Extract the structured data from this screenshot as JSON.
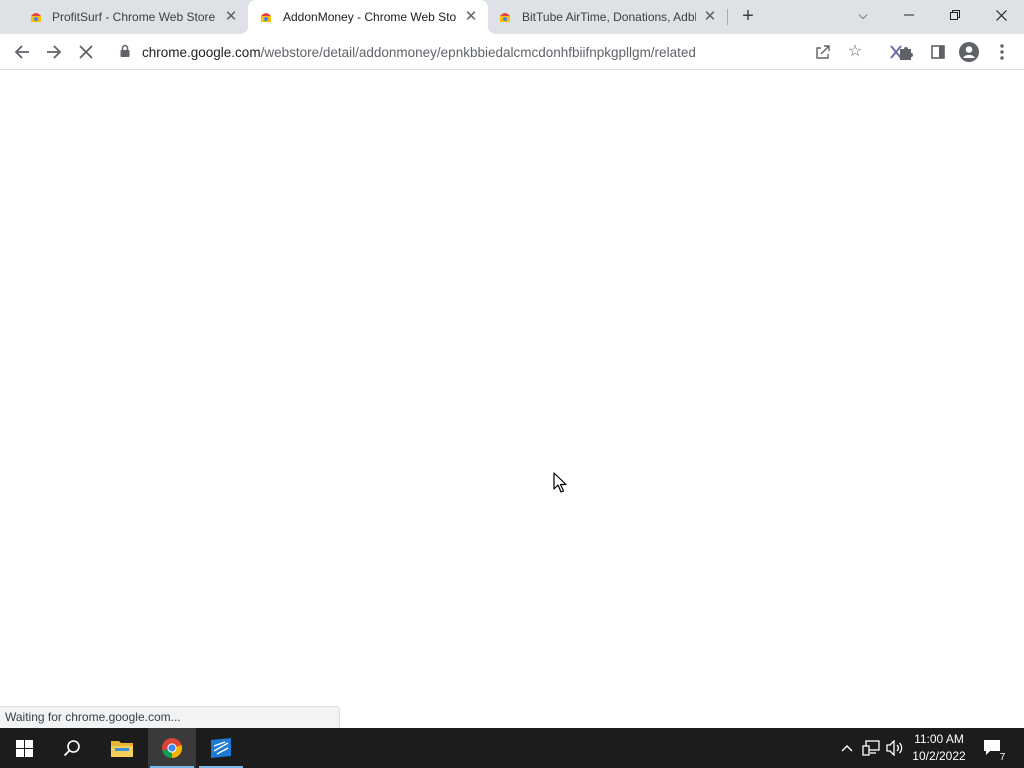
{
  "browser": {
    "tabs": [
      {
        "title": "ProfitSurf - Chrome Web Store",
        "active": false
      },
      {
        "title": "AddonMoney - Chrome Web Sto",
        "active": true
      },
      {
        "title": "BitTube AirTime, Donations, Adbl",
        "active": false
      }
    ],
    "url": {
      "host": "chrome.google.com",
      "path": "/webstore/detail/addonmoney/epnkbbiedalcmcdonhfbiifnpkgpllgm/related"
    },
    "status_text": "Waiting for chrome.google.com..."
  },
  "taskbar": {
    "time": "11:00 AM",
    "date": "10/2/2022",
    "notification_count": "7"
  },
  "icons": {
    "back": "arrow-left-icon",
    "forward": "arrow-right-icon",
    "reload": "stop-loading-icon",
    "lock": "lock-icon",
    "share": "share-icon",
    "bookmark": "star-icon",
    "extensions": "puzzle-icon",
    "side_panel": "side-panel-icon",
    "profile": "profile-icon",
    "menu": "kebab-menu-icon"
  },
  "colors": {
    "tab_strip": "#dee1e6",
    "taskbar": "#1c1c1c",
    "active_indicator": "#76b9ed"
  }
}
